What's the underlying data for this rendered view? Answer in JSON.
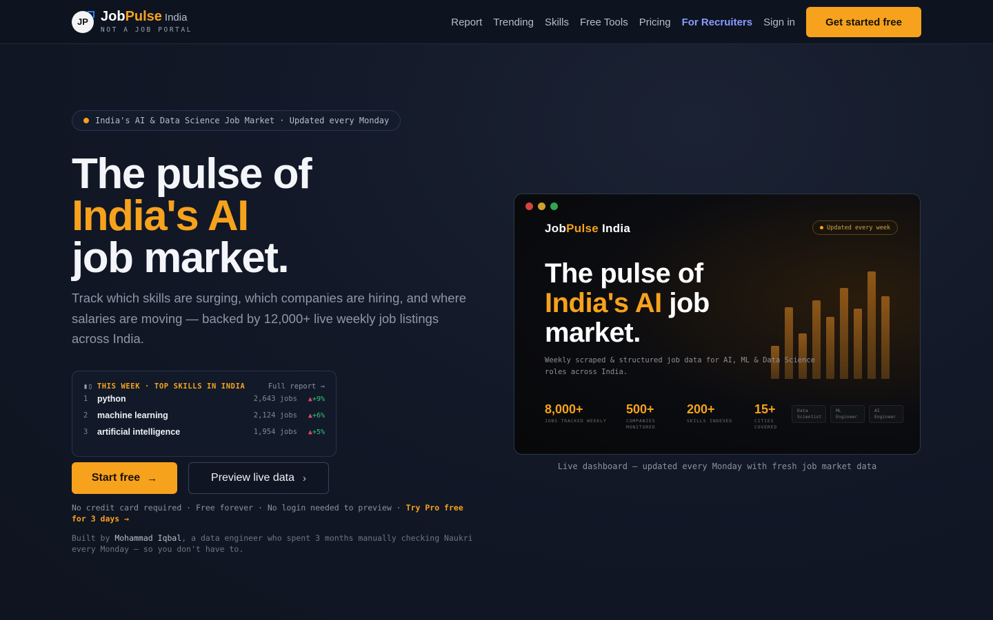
{
  "nav": {
    "brand_job": "Job",
    "brand_pulse": "Pulse",
    "brand_region": "India",
    "brand_mark": "JP",
    "tagline": "NOT A JOB PORTAL",
    "links": [
      "Report",
      "Trending",
      "Skills",
      "Free Tools",
      "Pricing"
    ],
    "recruiters": "For Recruiters",
    "signin": "Sign in",
    "cta": "Get started free"
  },
  "pill": "India's AI & Data Science Job Market · Updated every Monday",
  "hero": {
    "line1": "The pulse of",
    "line2": "India's AI",
    "line3": "job market.",
    "subtitle": "Track which skills are surging, which companies are hiring, and where salaries are moving — backed by 12,000+ live weekly job listings across India."
  },
  "skills_card": {
    "title": "THIS WEEK · TOP SKILLS IN INDIA",
    "link": "Full report →",
    "rows": [
      {
        "rank": "1",
        "name": "python",
        "jobs": "2,643 jobs",
        "change": "+9%"
      },
      {
        "rank": "2",
        "name": "machine learning",
        "jobs": "2,124 jobs",
        "change": "+6%"
      },
      {
        "rank": "3",
        "name": "artificial intelligence",
        "jobs": "1,954 jobs",
        "change": "+5%"
      }
    ]
  },
  "buttons": {
    "start": "Start free",
    "preview": "Preview live data"
  },
  "fineprint": {
    "text": "No credit card required · Free forever · No login needed to preview · ",
    "pro": "Try Pro free for 3 days →"
  },
  "builtby": {
    "prefix": "Built by ",
    "author": "Mohammad Iqbal",
    "suffix": ", a data engineer who spent 3 months manually checking Naukri every Monday — so you don't have to."
  },
  "preview": {
    "logo_job": "Job",
    "logo_pulse": "Pulse",
    "logo_rest": " India",
    "badge": "Updated every week",
    "title1": "The pulse of",
    "title2_accent": "India's AI",
    "title2_rest": " job",
    "title3": "market.",
    "desc": "Weekly scraped & structured job data for AI, ML & Data Science roles across India.",
    "stats": [
      {
        "num": "8,000+",
        "label": "JOBS TRACKED WEEKLY"
      },
      {
        "num": "500+",
        "label": "COMPANIES MONITORED"
      },
      {
        "num": "200+",
        "label": "SKILLS INDEXED"
      },
      {
        "num": "15+",
        "label": "CITIES COVERED"
      }
    ],
    "tags": [
      "Data Scientist",
      "ML Engineer",
      "AI Engineer"
    ],
    "caption": "Live dashboard — updated every Monday with fresh job market data"
  },
  "colors": {
    "accent": "#f6a21c",
    "recruiter_link": "#8a9cff",
    "positive": "#38c47a"
  }
}
